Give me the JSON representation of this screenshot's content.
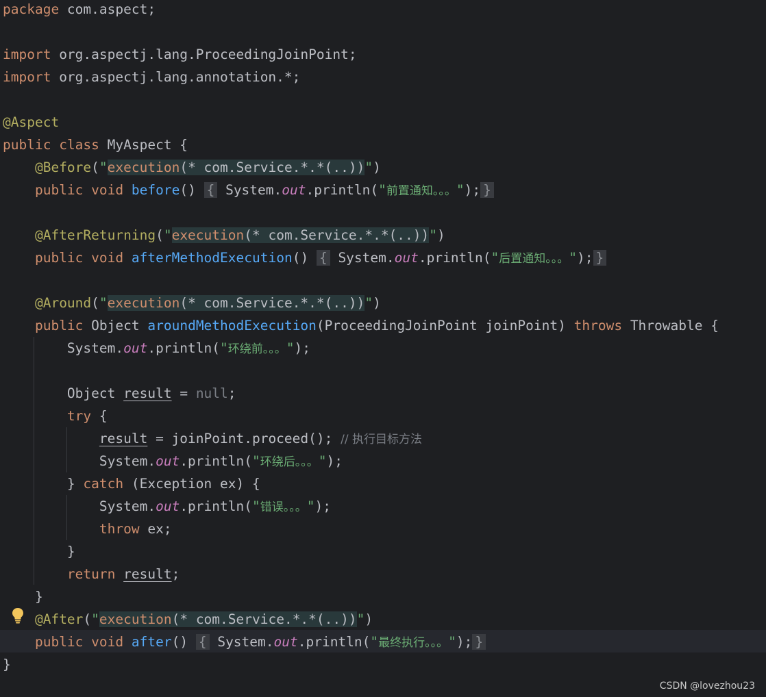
{
  "code": {
    "package_kw": "package",
    "package_name": " com.aspect;",
    "import_kw": "import",
    "import1": " org.aspectj.lang.ProceedingJoinPoint;",
    "import2": " org.aspectj.lang.annotation.*;",
    "aspect_ann": "@Aspect",
    "public_kw": "public",
    "class_kw": "class",
    "class_name": " MyAspect {",
    "before_ann": "@Before",
    "after_returning_ann": "@AfterReturning",
    "around_ann": "@Around",
    "after_ann": "@After",
    "pointcut_exec": "execution",
    "pointcut_rest": "(* com.Service.*.*(..))",
    "void_kw": "void",
    "before_name": "before",
    "after_method_name": "afterMethodExecution",
    "around_name": "aroundMethodExecution",
    "after_name": "after",
    "empty_params": "()",
    "system": "System.",
    "out": "out",
    "println": ".println(",
    "msg_before": "前置通知。。。",
    "msg_after_returning": "后置通知。。。",
    "msg_around_before": "环绕前。。。",
    "msg_around_after": "环绕后。。。",
    "msg_error": "错误。。。",
    "msg_final": "最终执行。。。",
    "object_type": "Object",
    "around_params": "(ProceedingJoinPoint joinPoint)",
    "throws_kw": "throws",
    "throwable": " Throwable {",
    "result_var": "result",
    "null_kw": "null",
    "try_kw": "try",
    "proceed_call": " = joinPoint.proceed();",
    "comment": "// 执行目标方法",
    "catch_kw": "catch",
    "catch_params": " (Exception ex) {",
    "throw_kw": "throw",
    "throw_rest": " ex;",
    "return_kw": "return"
  },
  "watermark": "CSDN @lovezhou23",
  "icons": {
    "bulb": "lightbulb-icon"
  }
}
